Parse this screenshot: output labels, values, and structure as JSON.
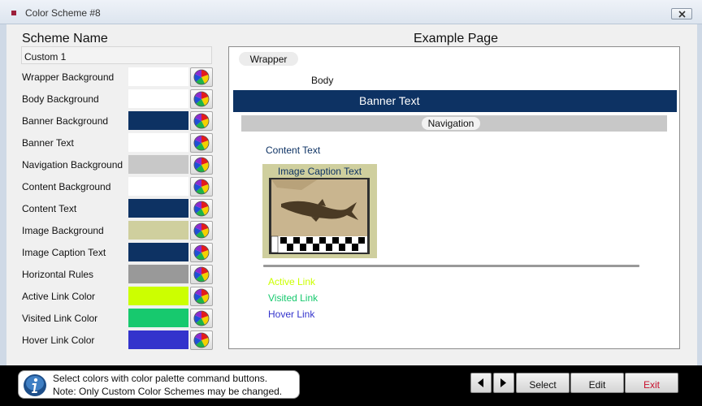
{
  "window": {
    "title": "Color Scheme #8",
    "close_icon": "close-icon"
  },
  "scheme": {
    "heading": "Scheme Name",
    "value": "Custom 1"
  },
  "color_rows": [
    {
      "label": "Wrapper Background",
      "color": "#ffffff"
    },
    {
      "label": "Body Background",
      "color": "#ffffff"
    },
    {
      "label": "Banner Background",
      "color": "#0d3263"
    },
    {
      "label": "Banner Text",
      "color": "#ffffff"
    },
    {
      "label": "Navigation Background",
      "color": "#c8c8c8"
    },
    {
      "label": "Content Background",
      "color": "#ffffff"
    },
    {
      "label": "Content Text",
      "color": "#0d3263"
    },
    {
      "label": "Image Background",
      "color": "#cfcf9e"
    },
    {
      "label": "Image Caption Text",
      "color": "#0d3263"
    },
    {
      "label": "Horizontal Rules",
      "color": "#999999"
    },
    {
      "label": "Active Link Color",
      "color": "#ccff00"
    },
    {
      "label": "Visited Link Color",
      "color": "#17c96e"
    },
    {
      "label": "Hover Link Color",
      "color": "#3333cc"
    }
  ],
  "example": {
    "heading": "Example Page",
    "wrapper": "Wrapper",
    "body": "Body",
    "banner": "Banner Text",
    "navigation": "Navigation",
    "content": "Content Text",
    "image_caption": "Image Caption Text",
    "active_link": "Active Link",
    "visited_link": "Visited Link",
    "hover_link": "Hover Link"
  },
  "footer": {
    "info_line1": "Select colors with color palette command buttons.",
    "info_line2": "Note: Only Custom Color Schemes may be changed.",
    "select": "Select",
    "edit": "Edit",
    "exit": "Exit",
    "exit_color": "#c8102e"
  }
}
